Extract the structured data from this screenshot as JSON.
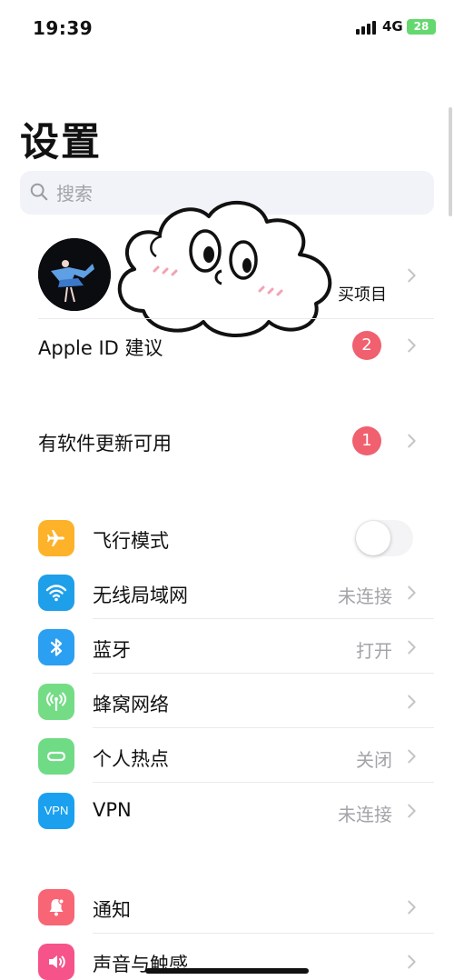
{
  "status_bar": {
    "time": "19:39",
    "network": "4G",
    "battery": "28"
  },
  "page_title": "设置",
  "search": {
    "placeholder": "搜索"
  },
  "profile": {
    "subtitle_fragment": "买项目"
  },
  "apple_id_suggestions": {
    "label": "Apple ID 建议",
    "badge": "2"
  },
  "software_update": {
    "label": "有软件更新可用",
    "badge": "1"
  },
  "connectivity": {
    "airplane": {
      "label": "飞行模式",
      "enabled": false
    },
    "wifi": {
      "label": "无线局域网",
      "value": "未连接"
    },
    "bluetooth": {
      "label": "蓝牙",
      "value": "打开"
    },
    "cellular": {
      "label": "蜂窝网络"
    },
    "hotspot": {
      "label": "个人热点",
      "value": "关闭"
    },
    "vpn": {
      "label": "VPN",
      "value": "未连接",
      "icon_text": "VPN"
    }
  },
  "notifications_group": {
    "notifications": {
      "label": "通知"
    },
    "sounds": {
      "label": "声音与触感"
    }
  },
  "colors": {
    "airplane": "#fdb22a",
    "wifi": "#1e9fe9",
    "bluetooth": "#2b9ff2",
    "cellular": "#75dc86",
    "hotspot": "#6fdb85",
    "vpn": "#1aa0ef",
    "notifications": "#f86575",
    "sounds": "#f5538a",
    "badge": "#f0606f"
  },
  "icons": [
    "search-icon",
    "airplane-icon",
    "wifi-icon",
    "bluetooth-icon",
    "antenna-icon",
    "link-icon",
    "bell-icon",
    "speaker-icon",
    "chevron-right-icon"
  ]
}
